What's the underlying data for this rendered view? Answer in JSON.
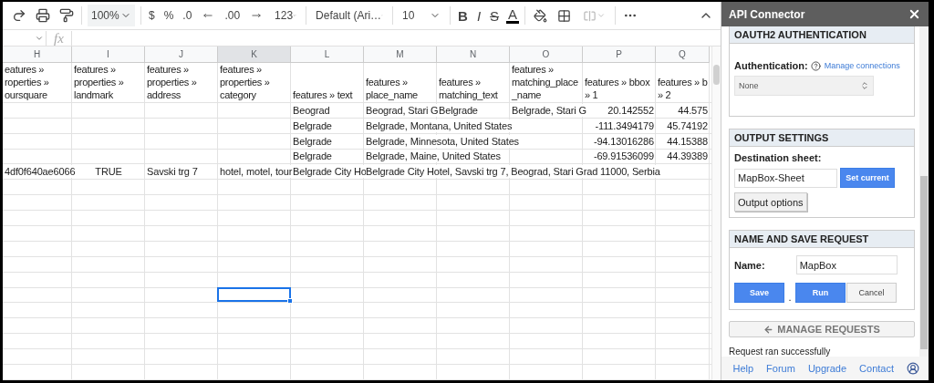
{
  "toolbar": {
    "zoom": "100%",
    "currency": "$",
    "percent": "%",
    "decrease_decimals": ".0",
    "increase_decimals": ".00",
    "more_formats": "123",
    "font": "Default (Ari…",
    "font_size": "10",
    "bold": "B",
    "italic": "I",
    "strikethrough": "S",
    "text_color": "A",
    "merge": {
      "disabled": true
    }
  },
  "formula_bar": {
    "fx": "fx"
  },
  "columns": [
    {
      "label": "H",
      "kind": "text",
      "selected": false
    },
    {
      "label": "I",
      "kind": "boolean",
      "selected": false
    },
    {
      "label": "J",
      "kind": "text",
      "selected": false
    },
    {
      "label": "K",
      "kind": "text",
      "selected": true
    },
    {
      "label": "L",
      "kind": "text",
      "selected": false
    },
    {
      "label": "M",
      "kind": "text",
      "selected": false
    },
    {
      "label": "N",
      "kind": "text",
      "selected": false
    },
    {
      "label": "O",
      "kind": "text",
      "selected": false
    },
    {
      "label": "P",
      "kind": "number",
      "selected": false
    },
    {
      "label": "Q",
      "kind": "number",
      "selected": false
    }
  ],
  "header_row": [
    [
      "eatures »",
      "roperties »",
      "oursquare"
    ],
    [
      "features »",
      "properties »",
      "landmark"
    ],
    [
      "features »",
      "properties »",
      "address"
    ],
    [
      "features »",
      "properties »",
      "category"
    ],
    [
      "features » text"
    ],
    [
      "features »",
      "place_name"
    ],
    [
      "features »",
      "matching_text"
    ],
    [
      "features »",
      "matching_place",
      "_name"
    ],
    [
      "features » bbox",
      "» 1"
    ],
    [
      "features » b",
      "» 2"
    ]
  ],
  "rows": [
    {
      "cells": [
        null,
        null,
        null,
        null,
        "Beograd",
        "Beograd, Stari G",
        "Belgrade",
        "Belgrade, Stari G",
        "20.142552",
        "44.575"
      ]
    },
    {
      "cells": [
        null,
        null,
        null,
        null,
        "Belgrade",
        "Belgrade, Montana, United States",
        null,
        null,
        "-111.3494179",
        "45.74192"
      ]
    },
    {
      "cells": [
        null,
        null,
        null,
        null,
        "Belgrade",
        "Belgrade, Minnesota, United States",
        null,
        null,
        "-94.13016286",
        "44.15388"
      ]
    },
    {
      "cells": [
        null,
        null,
        null,
        null,
        "Belgrade",
        "Belgrade, Maine, United States",
        null,
        null,
        "-69.91536099",
        "44.39389"
      ]
    },
    {
      "cells": [
        "4df0f640ae6066",
        "TRUE",
        "Savski trg 7",
        "hotel, motel, tour",
        "Belgrade City Ho",
        "Belgrade City Hotel, Savski trg 7, Beograd, Stari Grad 11000, Serbia",
        null,
        null,
        null,
        null
      ]
    }
  ],
  "empty_rows": [
    {
      "selected": false
    },
    {
      "selected": false
    },
    {
      "selected": false
    },
    {
      "selected": false
    },
    {
      "selected": false
    },
    {
      "selected": false
    },
    {
      "selected": false
    },
    {
      "selected": true
    },
    {
      "selected": false
    },
    {
      "selected": false
    },
    {
      "selected": false
    },
    {
      "selected": false
    },
    {
      "selected": false
    }
  ],
  "panel": {
    "title": "API Connector",
    "sections": [
      {
        "kind": "auth",
        "title": "OAUTH2 AUTHENTICATION",
        "label": "Authentication:",
        "link": "Manage connections",
        "select": "None"
      },
      {
        "kind": "output",
        "title": "OUTPUT SETTINGS",
        "label": "Destination sheet:",
        "value": "MapBox-Sheet",
        "set_button": "Set current",
        "options_button": "Output options"
      },
      {
        "kind": "save",
        "title": "NAME AND SAVE REQUEST",
        "label": "Name:",
        "value": "MapBox",
        "buttons": [
          {
            "label": "Save",
            "kind": "primary"
          },
          {
            "label": ".",
            "kind": "text"
          },
          {
            "label": "Run",
            "kind": "primary"
          },
          {
            "label": "Cancel",
            "kind": "secondary"
          }
        ]
      }
    ],
    "manage_button": "MANAGE REQUESTS",
    "status": "Request ran successfully",
    "footer_links": [
      "Help",
      "Forum",
      "Upgrade",
      "Contact"
    ]
  }
}
